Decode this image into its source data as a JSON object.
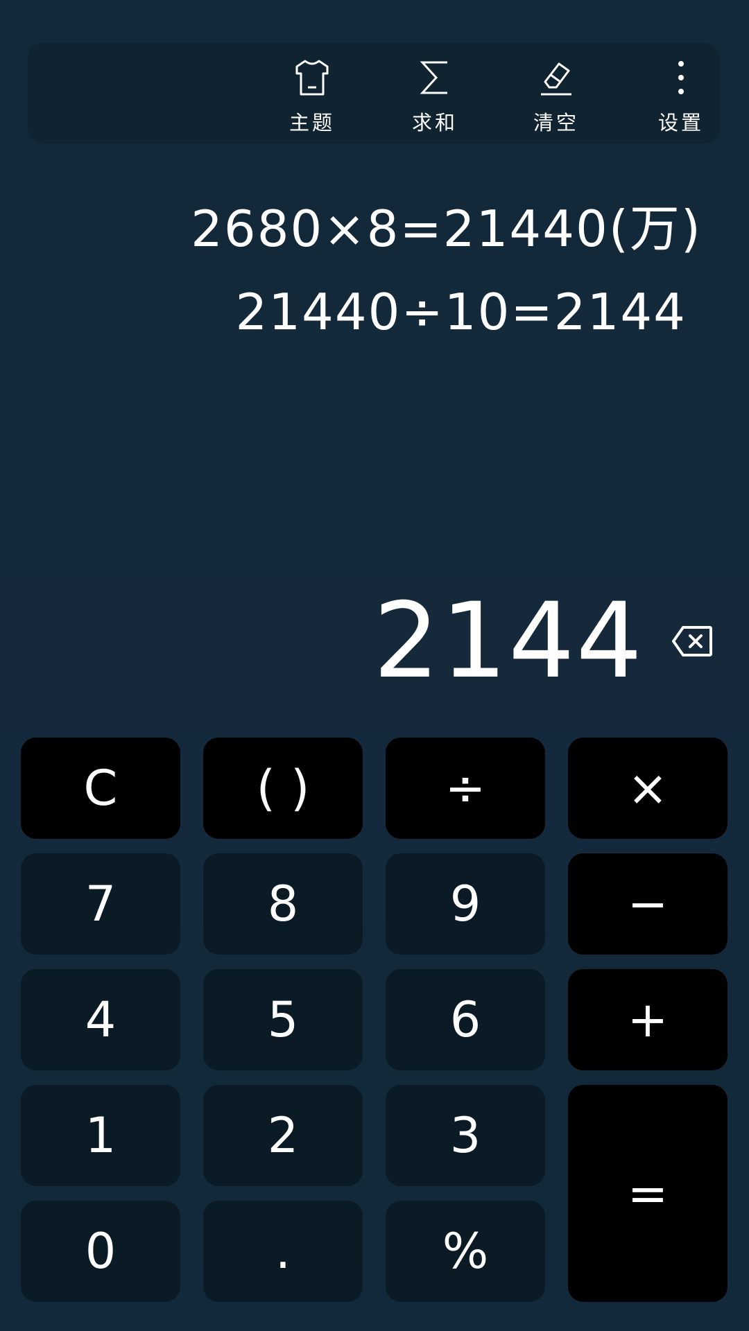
{
  "toolbar": {
    "theme": {
      "label": "主题",
      "icon": "shirt-icon"
    },
    "sum": {
      "label": "求和",
      "icon": "sigma-icon"
    },
    "clear": {
      "label": "清空",
      "icon": "eraser-icon"
    },
    "settings": {
      "label": "设置",
      "icon": "more-vertical-icon"
    }
  },
  "history": [
    "2680×8=21440(万)",
    "21440÷10=2144"
  ],
  "display": {
    "result": "2144",
    "backspace_icon": "backspace-icon"
  },
  "keys": {
    "clear": "C",
    "parens": "( )",
    "divide": "÷",
    "multiply": "×",
    "seven": "7",
    "eight": "8",
    "nine": "9",
    "minus": "−",
    "four": "4",
    "five": "5",
    "six": "6",
    "plus": "+",
    "one": "1",
    "two": "2",
    "three": "3",
    "equals": "=",
    "zero": "0",
    "dot": ".",
    "percent": "%"
  },
  "colors": {
    "background": "#132a38",
    "toolbar": "#0f2331",
    "digit_key": "#0b1b25",
    "operator_key": "#000000",
    "text": "#ffffff"
  }
}
